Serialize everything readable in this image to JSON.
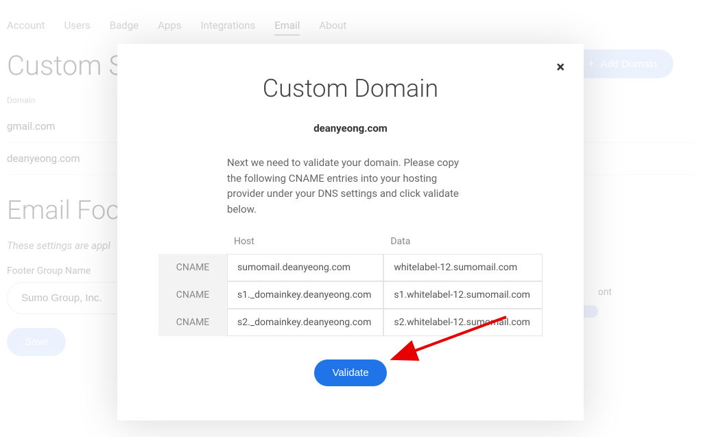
{
  "nav": {
    "items": [
      {
        "label": "Account",
        "active": false
      },
      {
        "label": "Users",
        "active": false
      },
      {
        "label": "Badge",
        "active": false
      },
      {
        "label": "Apps",
        "active": false
      },
      {
        "label": "Integrations",
        "active": false
      },
      {
        "label": "Email",
        "active": true
      },
      {
        "label": "About",
        "active": false
      }
    ]
  },
  "page": {
    "title": "Custom S",
    "addDomain": "Add Domain",
    "domainHeader": "Domain",
    "domains": [
      "gmail.com",
      "deanyeong.com"
    ],
    "footerSection": "Email Foo",
    "footerSubtitle": "These settings are appl",
    "footerGroupLabel": "Footer Group Name",
    "footerGroupValue": "Sumo Group, Inc.",
    "footerFontLabel": "ont",
    "saveLabel": "Save"
  },
  "modal": {
    "title": "Custom Domain",
    "domain": "deanyeong.com",
    "instructions": "Next we need to validate your domain. Please copy the following CNAME entries into your hosting provider under your DNS settings and click validate below.",
    "headers": {
      "type": "",
      "host": "Host",
      "data": "Data"
    },
    "records": [
      {
        "type": "CNAME",
        "host": "sumomail.deanyeong.com",
        "data": "whitelabel-12.sumomail.com"
      },
      {
        "type": "CNAME",
        "host": "s1._domainkey.deanyeong.com",
        "data": "s1.whitelabel-12.sumomail.com"
      },
      {
        "type": "CNAME",
        "host": "s2._domainkey.deanyeong.com",
        "data": "s2.whitelabel-12.sumomail.com"
      }
    ],
    "validateLabel": "Validate",
    "closeLabel": "×"
  }
}
